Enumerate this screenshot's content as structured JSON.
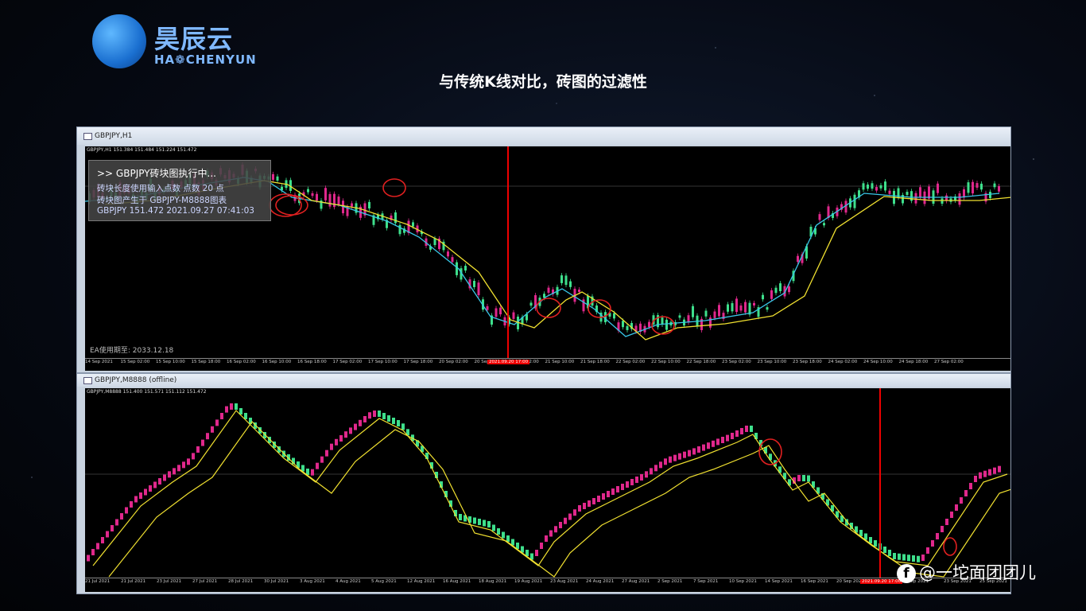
{
  "brand": {
    "name_cn": "昊辰云",
    "name_en": "HA❁CHENYUN",
    "color": "#7fb8ff"
  },
  "slide_title": "与传统K线对比，砖图的过滤性",
  "window_top": {
    "title": "GBPJPY,H1",
    "symbol_line": "GBPJPY,H1  151.384 151.484 151.224 151.472",
    "info_line1": ">> GBPJPY砖块图执行中...",
    "info_line2": "砖块长度使用输入点数 点数 20 点",
    "info_line3": "砖块图产生于 GBPJPY-M8888图表",
    "info_line4": "GBPJPY 151.472  2021.09.27 07:41:03",
    "ea_expire": "EA使用期至: 2033.12.18",
    "xaxis_labels": [
      "14 Sep 2021",
      "15 Sep 02:00",
      "15 Sep 10:00",
      "15 Sep 18:00",
      "16 Sep 02:00",
      "16 Sep 10:00",
      "16 Sep 18:00",
      "17 Sep 02:00",
      "17 Sep 10:00",
      "17 Sep 18:00",
      "20 Sep 02:00",
      "20 Sep 10:00",
      "21 Sep 02:00",
      "21 Sep 10:00",
      "21 Sep 18:00",
      "22 Sep 02:00",
      "22 Sep 10:00",
      "22 Sep 18:00",
      "23 Sep 02:00",
      "23 Sep 10:00",
      "23 Sep 18:00",
      "24 Sep 02:00",
      "24 Sep 10:00",
      "24 Sep 18:00",
      "27 Sep 02:00"
    ],
    "highlight_tag": "2021.09.20 17:00"
  },
  "window_bottom": {
    "title": "GBPJPY,M8888 (offline)",
    "symbol_line": "GBPJPY,M8888  151.400 151.571 151.112 151.472",
    "xaxis_labels": [
      "21 Jul 2021",
      "21 Jul 2021",
      "23 Jul 2021",
      "27 Jul 2021",
      "28 Jul 2021",
      "30 Jul 2021",
      "3 Aug 2021",
      "4 Aug 2021",
      "5 Aug 2021",
      "12 Aug 2021",
      "16 Aug 2021",
      "18 Aug 2021",
      "19 Aug 2021",
      "23 Aug 2021",
      "24 Aug 2021",
      "27 Aug 2021",
      "2 Sep 2021",
      "7 Sep 2021",
      "10 Sep 2021",
      "14 Sep 2021",
      "16 Sep 2021",
      "20 Sep 2021",
      "",
      "Sep 2021",
      "23 Sep 2021",
      "25 Sep 2021"
    ],
    "highlight_tag": "2021.09.20 17:00"
  },
  "colors": {
    "bull": "#e0288c",
    "bear": "#3ee08c",
    "ma_fast": "#38c8e8",
    "ma_slow": "#f0e030",
    "marker": "#e02020"
  },
  "watermark": "@一坨面团团儿",
  "watermark_icon": "f"
}
